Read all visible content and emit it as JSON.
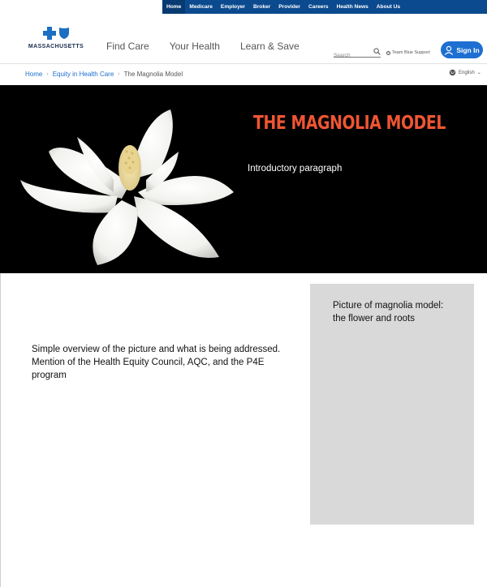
{
  "top_nav": {
    "items": [
      {
        "label": "Home",
        "active": true
      },
      {
        "label": "Medicare",
        "active": false
      },
      {
        "label": "Employer",
        "active": false
      },
      {
        "label": "Broker",
        "active": false
      },
      {
        "label": "Provider",
        "active": false
      },
      {
        "label": "Careers",
        "active": false
      },
      {
        "label": "Health News",
        "active": false
      },
      {
        "label": "About Us",
        "active": false
      }
    ]
  },
  "header": {
    "logo_text": "MASSACHUSETTS",
    "main_nav": [
      "Find Care",
      "Your Health",
      "Learn & Save"
    ],
    "search_placeholder": "Search",
    "support_label": "Team Blue Support",
    "sign_in_label": "Sign In"
  },
  "breadcrumb": {
    "items": [
      "Home",
      "Equity in Health Care"
    ],
    "current": "The Magnolia Model"
  },
  "language": {
    "selected": "English"
  },
  "hero": {
    "title": "THE MAGNOLIA MODEL",
    "intro": "Introductory paragraph"
  },
  "content": {
    "overview": "Simple overview of the picture and what is being addressed. Mention of the Health Equity Council, AQC, and the P4E program",
    "image_placeholder": "Picture of magnolia model: the flower and roots"
  },
  "colors": {
    "brand_blue": "#0b4a8f",
    "accent_blue": "#1d6fd1",
    "hero_title": "#ee5533",
    "hero_bg": "#000000",
    "placeholder_gray": "#d9d9d9"
  }
}
